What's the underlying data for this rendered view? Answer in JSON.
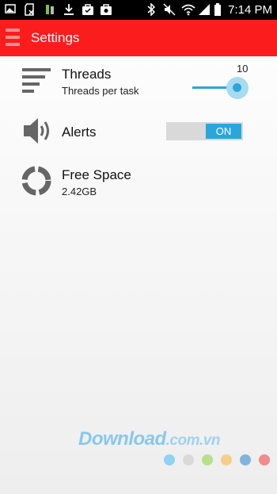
{
  "status_bar": {
    "time": "7:14 PM",
    "icons": [
      "image-icon",
      "sd-card-icon",
      "android-icon",
      "download-icon",
      "bag-icon",
      "camera-bag-icon",
      "bluetooth-icon",
      "mute-icon",
      "wifi-icon",
      "signal-icon",
      "battery-icon"
    ]
  },
  "app_bar": {
    "title": "Settings",
    "menu_icon": "hamburger-icon"
  },
  "settings": {
    "threads": {
      "icon": "lines-icon",
      "title": "Threads",
      "subtitle": "Threads per task",
      "value": "10",
      "slider_fraction": 0.95
    },
    "alerts": {
      "icon": "speaker-icon",
      "title": "Alerts",
      "toggle_label": "ON",
      "enabled": true
    },
    "free_space": {
      "icon": "ring-icon",
      "title": "Free Space",
      "value": "2.42GB"
    }
  },
  "watermark": {
    "brand": "Download",
    "domain": ".com.vn",
    "dot_colors": [
      "#8fd3f4",
      "#d9d9d9",
      "#b8e08a",
      "#f5cf8a",
      "#7fb5e0",
      "#f28b8b"
    ]
  },
  "colors": {
    "app_bar": "#fb1d1d",
    "accent": "#2ba6db"
  }
}
